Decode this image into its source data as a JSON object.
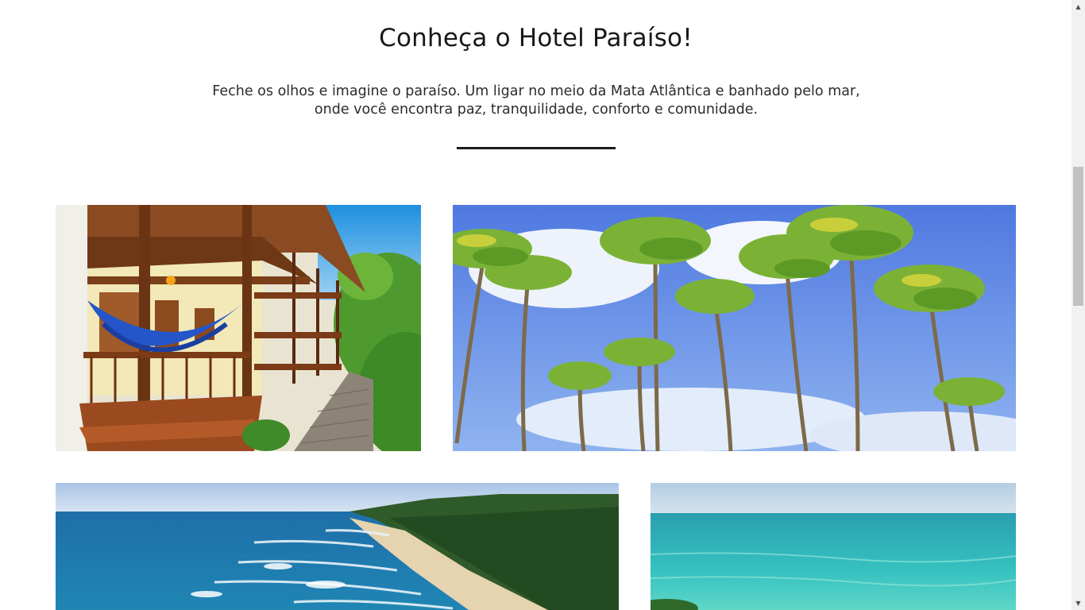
{
  "section": {
    "title": "Conheça o Hotel Paraíso!",
    "intro_line1": "Feche os olhos e imagine o paraíso. Um ligar no meio da Mata Atlântica e banhado pelo mar,",
    "intro_line2": "onde você encontra paz, tranquilidade, conforto e comunidade."
  },
  "gallery": [
    {
      "name": "hotel-building-photo"
    },
    {
      "name": "coconut-palms-photo"
    },
    {
      "name": "beach-coastline-photo"
    },
    {
      "name": "turquoise-sea-photo"
    }
  ],
  "colors": {
    "text": "#181818",
    "divider": "#1d1d1d",
    "sky": "#5b8fe6",
    "sea": "#2aa6b8"
  },
  "scrollbar": {
    "up_icon": "triangle-up-icon",
    "down_icon": "triangle-down-icon"
  }
}
